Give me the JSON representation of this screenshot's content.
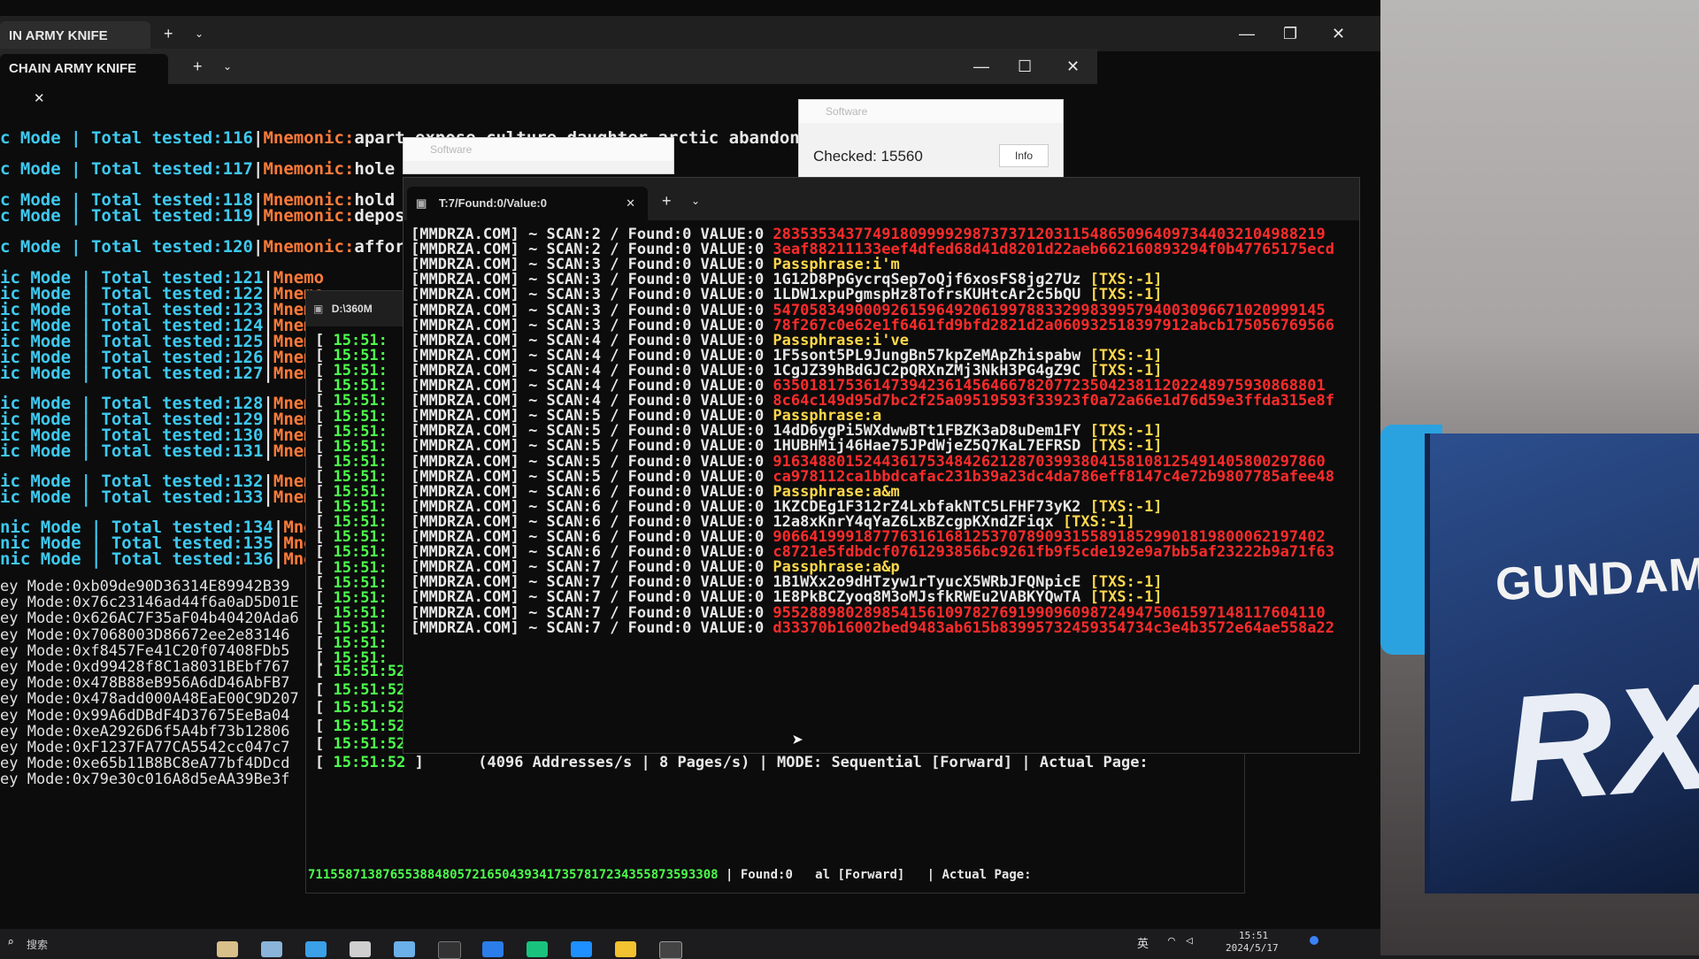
{
  "back_window": {
    "tab_title": "IN ARMY KNIFE",
    "controls": {
      "min": "—",
      "max": "❐",
      "close": "✕"
    }
  },
  "mid_window": {
    "tab_title": "CHAIN ARMY KNIFE",
    "controls": {
      "min": "—",
      "max": "☐",
      "close": "✕"
    },
    "lines": [
      {
        "mode": "c Mode",
        "total": "Total tested:116",
        "mnem": "Mnemonic:",
        "words": "apart expose culture daughter arctic abandon illn"
      },
      {
        "mode": "c Mode",
        "total": "Total tested:117",
        "mnem": "Mnemonic:",
        "words": "hole vi"
      },
      {
        "mode": "c Mode",
        "total": "Total tested:118",
        "mnem": "Mnemonic:",
        "words": "hold c"
      },
      {
        "mode": "c Mode",
        "total": "Total tested:119",
        "mnem": "Mnemonic:",
        "words": "deposi"
      },
      {
        "mode": "c Mode",
        "total": "Total tested:120",
        "mnem": "Mnemonic:",
        "words": "afford"
      },
      {
        "mode": "ic Mode",
        "total": "Total tested:121",
        "mnem": "Mnemo",
        "words": ""
      },
      {
        "mode": "ic Mode",
        "total": "Total tested:122",
        "mnem": "Mnemo",
        "words": ""
      },
      {
        "mode": "ic Mode",
        "total": "Total tested:123",
        "mnem": "Mnemo",
        "words": ""
      },
      {
        "mode": "ic Mode",
        "total": "Total tested:124",
        "mnem": "Mnemo",
        "words": ""
      },
      {
        "mode": "ic Mode",
        "total": "Total tested:125",
        "mnem": "Mnemo",
        "words": ""
      },
      {
        "mode": "ic Mode",
        "total": "Total tested:126",
        "mnem": "Mnemo",
        "words": ""
      },
      {
        "mode": "ic Mode",
        "total": "Total tested:127",
        "mnem": "Mnemo",
        "words": ""
      },
      {
        "mode": "ic Mode",
        "total": "Total tested:128",
        "mnem": "Mnemo",
        "words": ""
      },
      {
        "mode": "ic Mode",
        "total": "Total tested:129",
        "mnem": "Mnemo",
        "words": ""
      },
      {
        "mode": "ic Mode",
        "total": "Total tested:130",
        "mnem": "Mnemo",
        "words": ""
      },
      {
        "mode": "ic Mode",
        "total": "Total tested:131",
        "mnem": "Mnemo",
        "words": ""
      },
      {
        "mode": "ic Mode",
        "total": "Total tested:132",
        "mnem": "Mnemo",
        "words": ""
      },
      {
        "mode": "ic Mode",
        "total": "Total tested:133",
        "mnem": "Mnemo",
        "words": ""
      },
      {
        "mode": "nic Mode",
        "total": "Total tested:134",
        "mnem": "Mnemo",
        "words": ""
      },
      {
        "mode": "nic Mode",
        "total": "Total tested:135",
        "mnem": "Mnemo",
        "words": ""
      },
      {
        "mode": "nic Mode",
        "total": "Total tested:136",
        "mnem": "Mnemo",
        "words": ""
      }
    ],
    "key_lines": [
      "ey Mode:0xb09de90D36314E89942B39",
      "ey Mode:0x76c23146ad44f6a0aD5D01E",
      "ey Mode:0x626AC7F35aF04b40420Ada6",
      "ey Mode:0x7068003D86672ee2e83146",
      "ey Mode:0xf8457Fe41C20f07408FDb5",
      "ey Mode:0xd99428f8C1a8031BEbf767",
      "ey Mode:0x478B88eB956A6dD46AbFB7",
      "ey Mode:0x478add000A48EaE00C9D207",
      "ey Mode:0x99A6dDBdF4D37675EeBa04",
      "ey Mode:0xeA2926D6f5A4bf73b12806",
      "ey Mode:0xF1237FA77CA5542cc047c7",
      "ey Mode:0xe65b11B8BC8eA77bf4DDcd",
      "ey Mode:0x79e30c016A8d5eAA39Be3f"
    ]
  },
  "dialog_small": {
    "title": "Software"
  },
  "dialog_checked": {
    "title": "Software",
    "checked": "Checked: 15560",
    "info": "Info"
  },
  "front_window": {
    "tab_title": "T:7/Found:0/Value:0",
    "lines": [
      {
        "scan": "2",
        "kind": "red",
        "text": "2835353437749180999929873737120311548650964097344032104988219"
      },
      {
        "scan": "2",
        "kind": "red",
        "text": "3eaf88211133eef4dfed68d41d8201d22aeb662160893294f0b47765175ecd"
      },
      {
        "scan": "3",
        "kind": "yellow",
        "text": "Passphrase:i'm"
      },
      {
        "scan": "3",
        "kind": "addr",
        "text": "1G12D8PpGycrqSep7oQjf6xosFS8jg27Uz",
        "tx": "[TXS:-1]"
      },
      {
        "scan": "3",
        "kind": "addr",
        "text": "1LDW1xpuPgmspHz8TofrsKUHtcAr2c5bQU",
        "tx": "[TXS:-1]"
      },
      {
        "scan": "3",
        "kind": "red",
        "text": "5470583490009261596492061997883329983995794003096671020999145"
      },
      {
        "scan": "3",
        "kind": "red",
        "text": "78f267c0e62e1f6461fd9bfd2821d2a060932518397912abcb175056769566"
      },
      {
        "scan": "4",
        "kind": "yellow",
        "text": "Passphrase:i've"
      },
      {
        "scan": "4",
        "kind": "addr",
        "text": "1F5sont5PL9JungBn57kpZeMApZhispabw",
        "tx": "[TXS:-1]"
      },
      {
        "scan": "4",
        "kind": "addr",
        "text": "1CgJZ39hBdGJC2pQRXnZMj3NkH3PG4gZ9C",
        "tx": "[TXS:-1]"
      },
      {
        "scan": "4",
        "kind": "red",
        "text": "6350181753614739423614564667820772350423811202248975930868801"
      },
      {
        "scan": "4",
        "kind": "red",
        "text": "8c64c149d95d7bc2f25a09519593f33923f0a72a66e1d76d59e3ffda315e8f"
      },
      {
        "scan": "5",
        "kind": "yellow",
        "text": "Passphrase:a"
      },
      {
        "scan": "5",
        "kind": "addr",
        "text": "14dD6ygPi5WXdwwBTt1FBZK3aD8uDem1FY",
        "tx": "[TXS:-1]"
      },
      {
        "scan": "5",
        "kind": "addr",
        "text": "1HUBHMij46Hae75JPdWjeZ5Q7KaL7EFRSD",
        "tx": "[TXS:-1]"
      },
      {
        "scan": "5",
        "kind": "red",
        "text": "9163488015244361753484262128703993804158108125491405800297860"
      },
      {
        "scan": "5",
        "kind": "red",
        "text": "ca978112ca1bbdcafac231b39a23dc4da786eff8147c4e72b9807785afee48"
      },
      {
        "scan": "6",
        "kind": "yellow",
        "text": "Passphrase:a&m"
      },
      {
        "scan": "6",
        "kind": "addr",
        "text": "1KZCDEg1F312rZ4LxbfakNTC5LFHF73yK2",
        "tx": "[TXS:-1]"
      },
      {
        "scan": "6",
        "kind": "addr",
        "text": "12a8xKnrY4qYaZ6LxBZcgpKXndZFiqx",
        "tx": "[TXS:-1]"
      },
      {
        "scan": "6",
        "kind": "red",
        "text": "9066419991877763161681253707890931558918529901819800062197402"
      },
      {
        "scan": "6",
        "kind": "red",
        "text": "c8721e5fdbdcf0761293856bc9261fb9f5cde192e9a7bb5af23222b9a71f63"
      },
      {
        "scan": "7",
        "kind": "yellow",
        "text": "Passphrase:a&p"
      },
      {
        "scan": "7",
        "kind": "addr",
        "text": "1B1WXx2o9dHTzyw1rTyucX5WRbJFQNpicE",
        "tx": "[TXS:-1]"
      },
      {
        "scan": "7",
        "kind": "addr",
        "text": "1E8PkBCZyoq8M3oMJsfkRWEu2VABKYQwTA",
        "tx": "[TXS:-1]"
      },
      {
        "scan": "7",
        "kind": "red",
        "text": "9552889802898541561097827691990960987249475061597148117604110"
      },
      {
        "scan": "7",
        "kind": "red",
        "text": "d33370b16002bed9483ab615b83995732459354734c3e4b3572e64ae558a22"
      }
    ],
    "prefix": "[MMDRZA.COM]",
    "scan_label": "~ SCAN:",
    "found_label": "/ Found:0 VALUE:0"
  },
  "van_window": {
    "tab_title": "D:\\360M",
    "times_short": [
      "15:51:",
      "15:51:",
      "15:51:",
      "15:51:",
      "15:51:",
      "15:51:",
      "15:51:",
      "15:51:",
      "15:51:",
      "15:51:",
      "15:51:",
      "15:51:",
      "15:51:",
      "15:51:",
      "15:51:",
      "15:51:",
      "15:51:",
      "15:51:",
      "15:51:",
      "15:51:",
      "15:51:",
      "15:51:"
    ],
    "rows": [
      {
        "time": "15:51:52",
        "rate": "(4096 Addresses/s",
        "pages": "8 Pages/s)",
        "mode": "MODE: Sequential [Forward]",
        "page": "Actual Page:"
      },
      {
        "time": "15:51:52",
        "rate": "(4096 Addresses/s",
        "pages": "8 Pages/s)",
        "mode": "MODE: Sequential [Forward]",
        "page": "Actual Page:"
      },
      {
        "time": "15:51:52",
        "rate": "(4096 Addresses/s",
        "pages": "8 Pages/s)",
        "mode": "MODE: Sequential [Forward]",
        "page": "Actual Page:"
      },
      {
        "time": "15:51:52",
        "rate": "(4096 Addresses/s",
        "pages": "8 Pages/s)",
        "mode": "MODE: Sequential [Forward]",
        "page": "Actual Page:"
      },
      {
        "time": "15:51:52",
        "rate": "(4096 Addresses/s",
        "pages": "8 Pages/s)",
        "mode": "MODE: Sequential [Forward]",
        "page": "Actual Page:"
      },
      {
        "time": "15:51:52",
        "rate": "(4096 Addresses/s",
        "pages": "8 Pages/s)",
        "mode": "MODE: Sequential [Forward]",
        "page": "Actual Page:"
      }
    ],
    "bottom": "7115587138765538848057216504393417357817234355873593308",
    "bottom_found": "| Found:0",
    "bottom_mode": "al [Forward]",
    "bottom_page": "Actual Page:"
  },
  "taskbar": {
    "search": "搜索",
    "time": "15:51",
    "date": "2024/5/17",
    "ime": "英"
  },
  "background": {
    "logo": "GUNDAM",
    "big": "RX"
  },
  "colors": {
    "cyan": "#3ec9f0",
    "orange": "#ff7b39",
    "red": "#ff2b2b",
    "yellow": "#ffd84a",
    "green": "#4cff4c"
  }
}
